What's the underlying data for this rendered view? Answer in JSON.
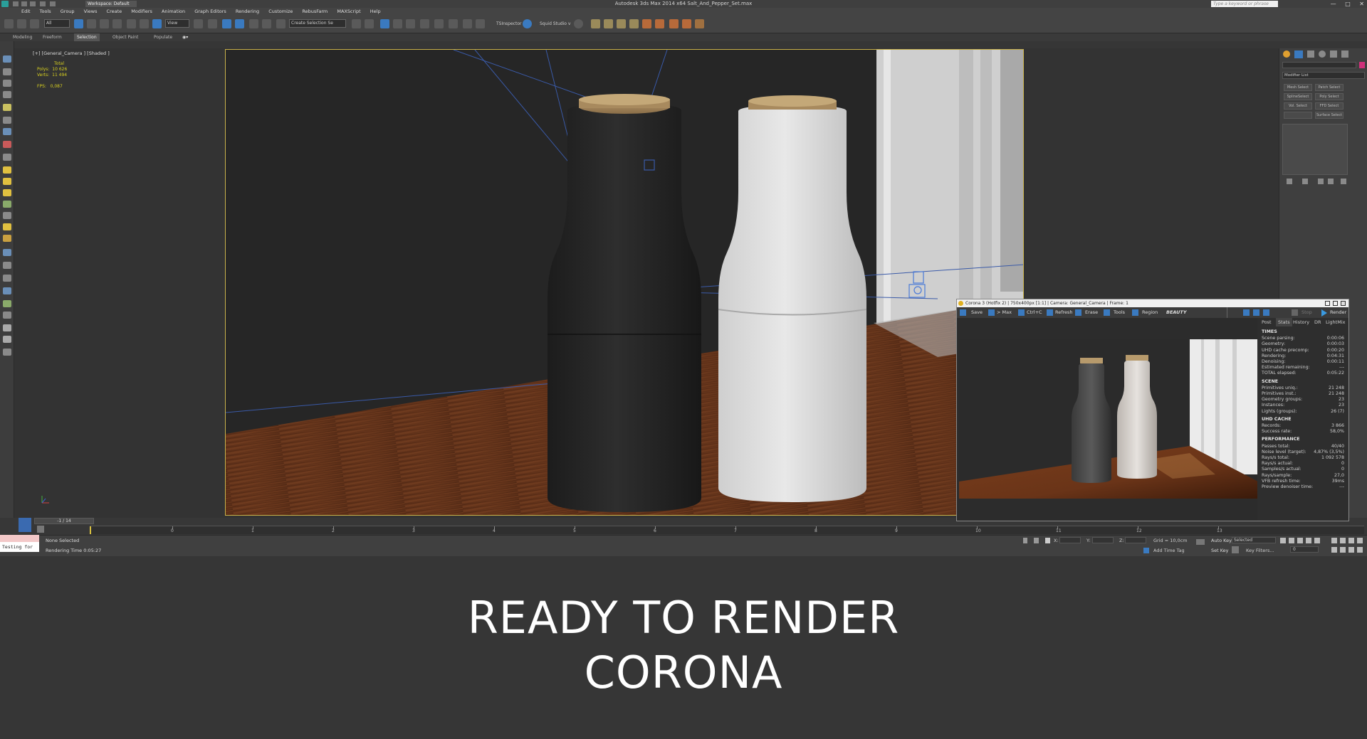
{
  "window": {
    "title": "Autodesk 3ds Max  2014 x64     Salt_And_Pepper_Set.max",
    "workspace": "Workspace: Default",
    "search_placeholder": "Type a keyword or phrase"
  },
  "menubar": [
    "Edit",
    "Tools",
    "Group",
    "Views",
    "Create",
    "Modifiers",
    "Animation",
    "Graph Editors",
    "Rendering",
    "Customize",
    "RebusFarm",
    "MAXScript",
    "Help"
  ],
  "toolbar": {
    "filter": "All",
    "ref_coord": "View",
    "selection_set": "Create Selection Se",
    "tsinspector": "TSInspector",
    "squid": "Squid Studio v"
  },
  "ribbon_tabs": [
    "Modeling",
    "Freeform",
    "Selection",
    "Object Paint",
    "Populate"
  ],
  "ribbon_active": "Selection",
  "viewport": {
    "label": "[+] [General_Camera ] [Shaded ]",
    "stats": {
      "header": "Total",
      "polys_label": "Polys:",
      "polys": "10 626",
      "verts_label": "Verts:",
      "verts": "11 494",
      "fps_label": "FPS:",
      "fps": "0,087"
    }
  },
  "timeline": {
    "frame_counter": "-1 / 14",
    "ticks": [
      "0",
      "1",
      "2",
      "3",
      "4",
      "5",
      "6",
      "7",
      "8",
      "9",
      "10",
      "11",
      "12",
      "13"
    ]
  },
  "status": {
    "listener": "Testing for",
    "selection": "None Selected",
    "render_time": "Rendering Time  0:05:27",
    "grid": "Grid = 10,0cm",
    "add_time_tag": "Add Time Tag",
    "auto_key": "Auto Key",
    "auto_key_mode": "Selected",
    "set_key": "Set Key",
    "key_filters": "Key Filters...",
    "x_label": "X:",
    "y_label": "Y:",
    "z_label": "Z:",
    "frame_field": "0"
  },
  "command_panel": {
    "modifier_list": "Modifier List",
    "buttons": [
      "Mesh Select",
      "Patch Select",
      "SplineSelect",
      "Poly Select",
      "Vol. Select",
      "FFD Select",
      "",
      "Surface Select"
    ]
  },
  "vfb": {
    "title": "Corona 3 (Hotfix 2) | 750x400px [1:1] | Camera: General_Camera | Frame: 1",
    "toolbar": {
      "save": "Save",
      "max": "> Max",
      "ctrlc": "Ctrl+C",
      "refresh": "Refresh",
      "erase": "Erase",
      "tools": "Tools",
      "region": "Region",
      "pass": "BEAUTY",
      "stop": "Stop",
      "render": "Render"
    },
    "tabs": [
      "Post",
      "Stats",
      "History",
      "DR",
      "LightMix"
    ],
    "active_tab": "Stats",
    "sections": [
      {
        "title": "TIMES",
        "rows": [
          [
            "Scene parsing:",
            "0:00:06"
          ],
          [
            "Geometry:",
            "0:00:03"
          ],
          [
            "UHD cache precomp:",
            "0:00:20"
          ],
          [
            "Rendering:",
            "0:04:31"
          ],
          [
            "Denoising:",
            "0:00:11"
          ],
          [
            "Estimated remaining:",
            "---"
          ],
          [
            "TOTAL elapsed:",
            "0:05:22"
          ]
        ]
      },
      {
        "title": "SCENE",
        "rows": [
          [
            "Primitives uniq.:",
            "21 248"
          ],
          [
            "Primitives inst.:",
            "21 248"
          ],
          [
            "Geometry groups:",
            "23"
          ],
          [
            "Instances:",
            "23"
          ],
          [
            "Lights (groups):",
            "26 (7)"
          ]
        ]
      },
      {
        "title": "UHD CACHE",
        "rows": [
          [
            "Records:",
            "3 866"
          ],
          [
            "Success rate:",
            "58,0%"
          ]
        ]
      },
      {
        "title": "PERFORMANCE",
        "rows": [
          [
            "Passes total:",
            "40/40"
          ],
          [
            "Noise level (target):",
            "4,87% (3,5%)"
          ],
          [
            "Rays/s total:",
            "1 092 578"
          ],
          [
            "Rays/s actual:",
            "0"
          ],
          [
            "Samples/s actual:",
            "0"
          ],
          [
            "Rays/sample:",
            "27,0"
          ],
          [
            "VFB refresh time:",
            "39ms"
          ],
          [
            "Preview denoiser time:",
            "---"
          ]
        ]
      }
    ]
  },
  "caption": {
    "line1": "READY TO RENDER",
    "line2": "CORONA"
  }
}
